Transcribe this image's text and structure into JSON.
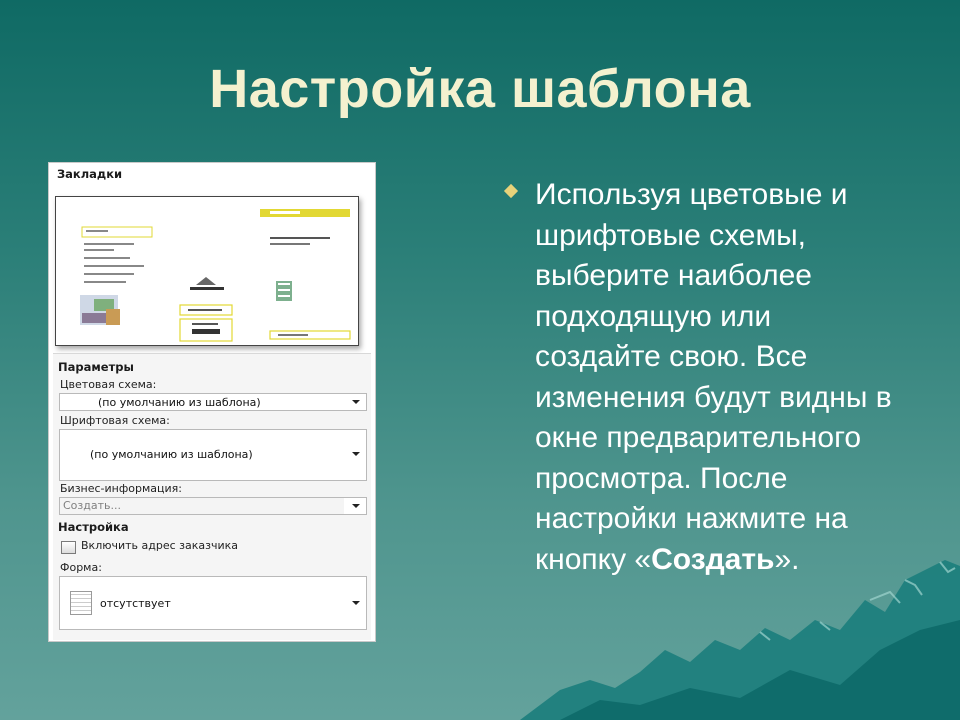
{
  "slide": {
    "title": "Настройка шаблона",
    "bullet": {
      "text_before": "Используя цветовые и шрифтовые схемы, выберите наиболее подходящую или создайте свою. Все изменения будут видны в окне предварительного просмотра. После настройки нажмите на кнопку «",
      "bold_word": "Создать",
      "text_after": "»."
    }
  },
  "panel": {
    "bookmarks_heading": "Закладки",
    "params_heading": "Параметры",
    "color_scheme": {
      "label": "Цветовая схема:",
      "value": "(по умолчанию из шаблона)"
    },
    "font_scheme": {
      "label": "Шрифтовая схема:",
      "value": "(по умолчанию из шаблона)"
    },
    "business_info": {
      "label": "Бизнес-информация:",
      "value": "Создать..."
    },
    "settings_heading": "Настройка",
    "include_address": {
      "label": "Включить адрес заказчика",
      "checked": false
    },
    "form": {
      "label": "Форма:",
      "value": "отсутствует"
    }
  },
  "colors": {
    "title": "#f4f1cf",
    "bullet": "#e8d27a",
    "text": "#ffffff",
    "accent_yellow": "#e2d834"
  }
}
